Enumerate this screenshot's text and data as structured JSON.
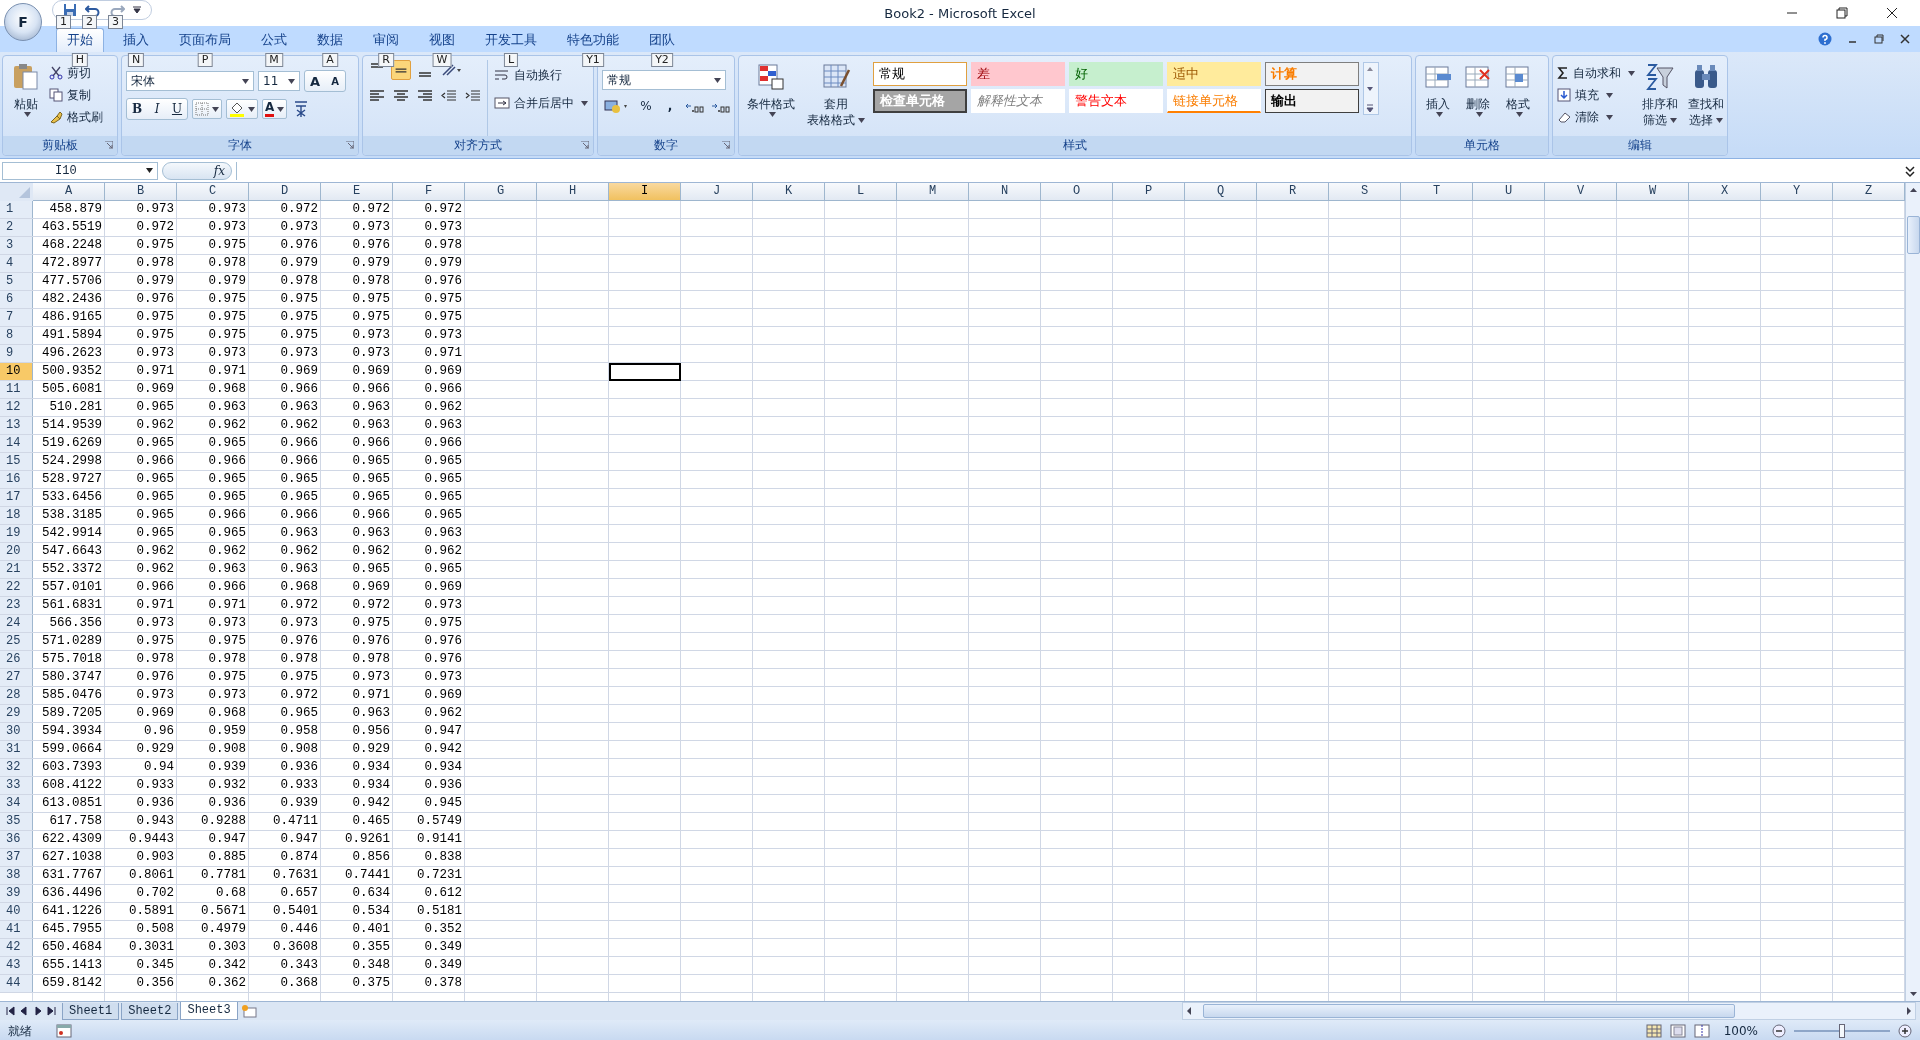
{
  "window": {
    "title": "Book2 - Microsoft Excel",
    "office_button": "F",
    "quick_keytips": [
      "1",
      "2",
      "3"
    ]
  },
  "tabs": [
    {
      "label": "开始",
      "keytip": "H",
      "selected": true
    },
    {
      "label": "插入",
      "keytip": "N",
      "selected": false
    },
    {
      "label": "页面布局",
      "keytip": "P",
      "selected": false
    },
    {
      "label": "公式",
      "keytip": "M",
      "selected": false
    },
    {
      "label": "数据",
      "keytip": "A",
      "selected": false
    },
    {
      "label": "审阅",
      "keytip": "R",
      "selected": false
    },
    {
      "label": "视图",
      "keytip": "W",
      "selected": false
    },
    {
      "label": "开发工具",
      "keytip": "L",
      "selected": false
    },
    {
      "label": "特色功能",
      "keytip": "Y1",
      "selected": false
    },
    {
      "label": "团队",
      "keytip": "Y2",
      "selected": false
    }
  ],
  "ribbon": {
    "clipboard": {
      "label": "剪贴板",
      "paste": "粘贴",
      "items": [
        "剪切",
        "复制",
        "格式刷"
      ]
    },
    "font": {
      "label": "字体",
      "font_name": "宋体",
      "font_size": "11",
      "grow": "A",
      "shrink": "A",
      "styles": [
        "B",
        "I",
        "U"
      ],
      "font_color": "A"
    },
    "alignment": {
      "label": "对齐方式",
      "wrap": "自动换行",
      "merge": "合并后居中"
    },
    "number": {
      "label": "数字",
      "format": "常规",
      "percent": "%",
      "comma": ","
    },
    "styles": {
      "label": "样式",
      "conditional": "条件格式",
      "table": [
        "套用",
        "表格格式"
      ],
      "cell_styles": [
        {
          "label": "常规",
          "kind": "normal"
        },
        {
          "label": "差",
          "kind": "bad"
        },
        {
          "label": "好",
          "kind": "good"
        },
        {
          "label": "适中",
          "kind": "neutral"
        },
        {
          "label": "计算",
          "kind": "calc"
        },
        {
          "label": "检查单元格",
          "kind": "check"
        },
        {
          "label": "解释性文本",
          "kind": "explanatory"
        },
        {
          "label": "警告文本",
          "kind": "warning"
        },
        {
          "label": "链接单元格",
          "kind": "linked"
        },
        {
          "label": "输出",
          "kind": "output"
        }
      ]
    },
    "cells": {
      "label": "单元格",
      "items": [
        "插入",
        "删除",
        "格式"
      ]
    },
    "editing": {
      "label": "编辑",
      "autosum": "自动求和",
      "fill": "填充",
      "clear": "清除",
      "sort": [
        "排序和",
        "筛选"
      ],
      "find": [
        "查找和",
        "选择"
      ]
    }
  },
  "formula_bar": {
    "name_box": "I10",
    "fx": "fx"
  },
  "columns": [
    {
      "label": "A",
      "selected": false
    },
    {
      "label": "B",
      "selected": false
    },
    {
      "label": "C",
      "selected": false
    },
    {
      "label": "D",
      "selected": false
    },
    {
      "label": "E",
      "selected": false
    },
    {
      "label": "F",
      "selected": false
    },
    {
      "label": "G",
      "selected": false
    },
    {
      "label": "H",
      "selected": false
    },
    {
      "label": "I",
      "selected": true
    },
    {
      "label": "J",
      "selected": false
    },
    {
      "label": "K",
      "selected": false
    },
    {
      "label": "L",
      "selected": false
    },
    {
      "label": "M",
      "selected": false
    },
    {
      "label": "N",
      "selected": false
    },
    {
      "label": "O",
      "selected": false
    },
    {
      "label": "P",
      "selected": false
    },
    {
      "label": "Q",
      "selected": false
    },
    {
      "label": "R",
      "selected": false
    },
    {
      "label": "S",
      "selected": false
    },
    {
      "label": "T",
      "selected": false
    },
    {
      "label": "U",
      "selected": false
    },
    {
      "label": "V",
      "selected": false
    },
    {
      "label": "W",
      "selected": false
    },
    {
      "label": "X",
      "selected": false
    },
    {
      "label": "Y",
      "selected": false
    },
    {
      "label": "Z",
      "selected": false
    }
  ],
  "rows": [
    {
      "n": "1",
      "selected": false,
      "cells": [
        "458.879",
        "0.973",
        "0.973",
        "0.972",
        "0.972",
        "0.972"
      ]
    },
    {
      "n": "2",
      "selected": false,
      "cells": [
        "463.5519",
        "0.972",
        "0.973",
        "0.973",
        "0.973",
        "0.973"
      ]
    },
    {
      "n": "3",
      "selected": false,
      "cells": [
        "468.2248",
        "0.975",
        "0.975",
        "0.976",
        "0.976",
        "0.978"
      ]
    },
    {
      "n": "4",
      "selected": false,
      "cells": [
        "472.8977",
        "0.978",
        "0.978",
        "0.979",
        "0.979",
        "0.979"
      ]
    },
    {
      "n": "5",
      "selected": false,
      "cells": [
        "477.5706",
        "0.979",
        "0.979",
        "0.978",
        "0.978",
        "0.976"
      ]
    },
    {
      "n": "6",
      "selected": false,
      "cells": [
        "482.2436",
        "0.976",
        "0.975",
        "0.975",
        "0.975",
        "0.975"
      ]
    },
    {
      "n": "7",
      "selected": false,
      "cells": [
        "486.9165",
        "0.975",
        "0.975",
        "0.975",
        "0.975",
        "0.975"
      ]
    },
    {
      "n": "8",
      "selected": false,
      "cells": [
        "491.5894",
        "0.975",
        "0.975",
        "0.975",
        "0.973",
        "0.973"
      ]
    },
    {
      "n": "9",
      "selected": false,
      "cells": [
        "496.2623",
        "0.973",
        "0.973",
        "0.973",
        "0.973",
        "0.971"
      ]
    },
    {
      "n": "10",
      "selected": true,
      "cells": [
        "500.9352",
        "0.971",
        "0.971",
        "0.969",
        "0.969",
        "0.969"
      ]
    },
    {
      "n": "11",
      "selected": false,
      "cells": [
        "505.6081",
        "0.969",
        "0.968",
        "0.966",
        "0.966",
        "0.966"
      ]
    },
    {
      "n": "12",
      "selected": false,
      "cells": [
        "510.281",
        "0.965",
        "0.963",
        "0.963",
        "0.963",
        "0.962"
      ]
    },
    {
      "n": "13",
      "selected": false,
      "cells": [
        "514.9539",
        "0.962",
        "0.962",
        "0.962",
        "0.963",
        "0.963"
      ]
    },
    {
      "n": "14",
      "selected": false,
      "cells": [
        "519.6269",
        "0.965",
        "0.965",
        "0.966",
        "0.966",
        "0.966"
      ]
    },
    {
      "n": "15",
      "selected": false,
      "cells": [
        "524.2998",
        "0.966",
        "0.966",
        "0.966",
        "0.965",
        "0.965"
      ]
    },
    {
      "n": "16",
      "selected": false,
      "cells": [
        "528.9727",
        "0.965",
        "0.965",
        "0.965",
        "0.965",
        "0.965"
      ]
    },
    {
      "n": "17",
      "selected": false,
      "cells": [
        "533.6456",
        "0.965",
        "0.965",
        "0.965",
        "0.965",
        "0.965"
      ]
    },
    {
      "n": "18",
      "selected": false,
      "cells": [
        "538.3185",
        "0.965",
        "0.966",
        "0.966",
        "0.966",
        "0.965"
      ]
    },
    {
      "n": "19",
      "selected": false,
      "cells": [
        "542.9914",
        "0.965",
        "0.965",
        "0.963",
        "0.963",
        "0.963"
      ]
    },
    {
      "n": "20",
      "selected": false,
      "cells": [
        "547.6643",
        "0.962",
        "0.962",
        "0.962",
        "0.962",
        "0.962"
      ]
    },
    {
      "n": "21",
      "selected": false,
      "cells": [
        "552.3372",
        "0.962",
        "0.963",
        "0.963",
        "0.965",
        "0.965"
      ]
    },
    {
      "n": "22",
      "selected": false,
      "cells": [
        "557.0101",
        "0.966",
        "0.966",
        "0.968",
        "0.969",
        "0.969"
      ]
    },
    {
      "n": "23",
      "selected": false,
      "cells": [
        "561.6831",
        "0.971",
        "0.971",
        "0.972",
        "0.972",
        "0.973"
      ]
    },
    {
      "n": "24",
      "selected": false,
      "cells": [
        "566.356",
        "0.973",
        "0.973",
        "0.973",
        "0.975",
        "0.975"
      ]
    },
    {
      "n": "25",
      "selected": false,
      "cells": [
        "571.0289",
        "0.975",
        "0.975",
        "0.976",
        "0.976",
        "0.976"
      ]
    },
    {
      "n": "26",
      "selected": false,
      "cells": [
        "575.7018",
        "0.978",
        "0.978",
        "0.978",
        "0.978",
        "0.976"
      ]
    },
    {
      "n": "27",
      "selected": false,
      "cells": [
        "580.3747",
        "0.976",
        "0.975",
        "0.975",
        "0.973",
        "0.973"
      ]
    },
    {
      "n": "28",
      "selected": false,
      "cells": [
        "585.0476",
        "0.973",
        "0.973",
        "0.972",
        "0.971",
        "0.969"
      ]
    },
    {
      "n": "29",
      "selected": false,
      "cells": [
        "589.7205",
        "0.969",
        "0.968",
        "0.965",
        "0.963",
        "0.962"
      ]
    },
    {
      "n": "30",
      "selected": false,
      "cells": [
        "594.3934",
        "0.96",
        "0.959",
        "0.958",
        "0.956",
        "0.947"
      ]
    },
    {
      "n": "31",
      "selected": false,
      "cells": [
        "599.0664",
        "0.929",
        "0.908",
        "0.908",
        "0.929",
        "0.942"
      ]
    },
    {
      "n": "32",
      "selected": false,
      "cells": [
        "603.7393",
        "0.94",
        "0.939",
        "0.936",
        "0.934",
        "0.934"
      ]
    },
    {
      "n": "33",
      "selected": false,
      "cells": [
        "608.4122",
        "0.933",
        "0.932",
        "0.933",
        "0.934",
        "0.936"
      ]
    },
    {
      "n": "34",
      "selected": false,
      "cells": [
        "613.0851",
        "0.936",
        "0.936",
        "0.939",
        "0.942",
        "0.945"
      ]
    },
    {
      "n": "35",
      "selected": false,
      "cells": [
        "617.758",
        "0.943",
        "0.9288",
        "0.4711",
        "0.465",
        "0.5749"
      ]
    },
    {
      "n": "36",
      "selected": false,
      "cells": [
        "622.4309",
        "0.9443",
        "0.947",
        "0.947",
        "0.9261",
        "0.9141"
      ]
    },
    {
      "n": "37",
      "selected": false,
      "cells": [
        "627.1038",
        "0.903",
        "0.885",
        "0.874",
        "0.856",
        "0.838"
      ]
    },
    {
      "n": "38",
      "selected": false,
      "cells": [
        "631.7767",
        "0.8061",
        "0.7781",
        "0.7631",
        "0.7441",
        "0.7231"
      ]
    },
    {
      "n": "39",
      "selected": false,
      "cells": [
        "636.4496",
        "0.702",
        "0.68",
        "0.657",
        "0.634",
        "0.612"
      ]
    },
    {
      "n": "40",
      "selected": false,
      "cells": [
        "641.1226",
        "0.5891",
        "0.5671",
        "0.5401",
        "0.534",
        "0.5181"
      ]
    },
    {
      "n": "41",
      "selected": false,
      "cells": [
        "645.7955",
        "0.508",
        "0.4979",
        "0.446",
        "0.401",
        "0.352"
      ]
    },
    {
      "n": "42",
      "selected": false,
      "cells": [
        "650.4684",
        "0.3031",
        "0.303",
        "0.3608",
        "0.355",
        "0.349"
      ]
    },
    {
      "n": "43",
      "selected": false,
      "cells": [
        "655.1413",
        "0.345",
        "0.342",
        "0.343",
        "0.348",
        "0.349"
      ]
    },
    {
      "n": "44",
      "selected": false,
      "cells": [
        "659.8142",
        "0.356",
        "0.362",
        "0.368",
        "0.375",
        "0.378"
      ]
    }
  ],
  "sheet_tabs": [
    {
      "label": "Sheet1",
      "selected": false
    },
    {
      "label": "Sheet2",
      "selected": false
    },
    {
      "label": "Sheet3",
      "selected": true
    }
  ],
  "status_bar": {
    "status": "就绪",
    "zoom": "100%",
    "zoom_slider": {
      "level": 0.5
    }
  }
}
